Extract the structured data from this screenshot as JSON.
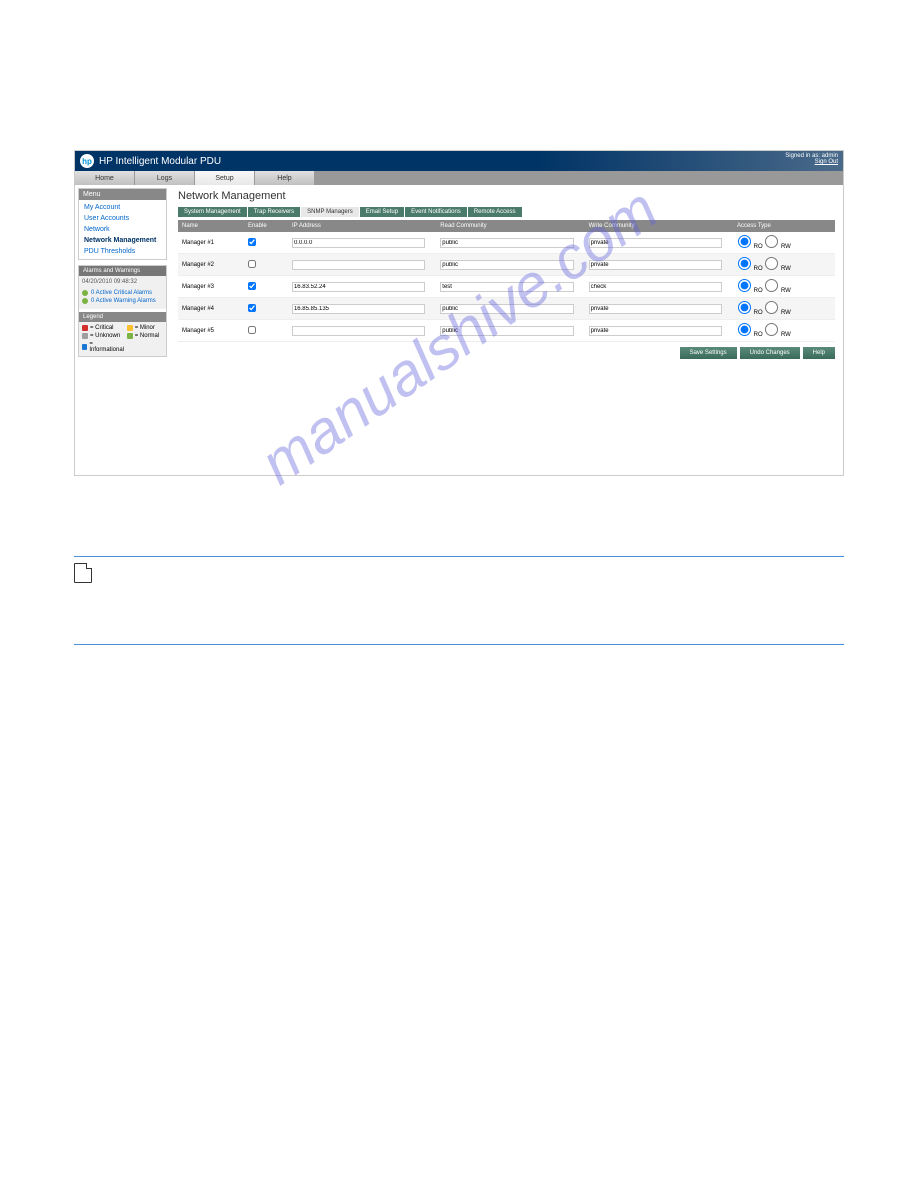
{
  "watermark": "manualshive.com",
  "header": {
    "logo_text": "hp",
    "title": "HP Intelligent Modular PDU",
    "signed_in": "Signed in as: admin",
    "sign_out": "Sign Out"
  },
  "tabs": {
    "items": [
      "Home",
      "Logs",
      "Setup",
      "Help"
    ],
    "active": 2
  },
  "menu": {
    "header": "Menu",
    "items": [
      "My Account",
      "User Accounts",
      "Network",
      "Network Management",
      "PDU Thresholds"
    ],
    "active": 3
  },
  "alarms": {
    "header": "Alarms and Warnings",
    "timestamp": "04/20/2010 09:48:32",
    "lines": [
      {
        "text": "0 Active Critical Alarms"
      },
      {
        "text": "0 Active Warning Alarms"
      }
    ]
  },
  "legend": {
    "header": "Legend",
    "items": [
      {
        "color": "red",
        "label": "= Critical"
      },
      {
        "color": "yellow",
        "label": "= Minor"
      },
      {
        "color": "grey",
        "label": "= Unknown"
      },
      {
        "color": "green",
        "label": "= Normal"
      },
      {
        "color": "blue",
        "label": "= Informational"
      }
    ]
  },
  "page": {
    "title": "Network Management",
    "sub_tabs": [
      "System Management",
      "Trap Receivers",
      "SNMP Managers",
      "Email Setup",
      "Event Notifications",
      "Remote Access"
    ],
    "sub_active": 2
  },
  "table": {
    "headers": [
      "Name",
      "Enable",
      "IP Address",
      "Read Community",
      "Write Community",
      "Access Type"
    ],
    "access_ro": "RO",
    "access_rw": "RW",
    "rows": [
      {
        "name": "Manager #1",
        "enabled": true,
        "ip": "0.0.0.0",
        "read": "public",
        "write": "private",
        "access": "ro"
      },
      {
        "name": "Manager #2",
        "enabled": false,
        "ip": "",
        "read": "public",
        "write": "private",
        "access": "ro"
      },
      {
        "name": "Manager #3",
        "enabled": true,
        "ip": "16.83.52.24",
        "read": "test",
        "write": "check",
        "access": "ro"
      },
      {
        "name": "Manager #4",
        "enabled": true,
        "ip": "16.85.85.135",
        "read": "public",
        "write": "private",
        "access": "ro"
      },
      {
        "name": "Manager #5",
        "enabled": false,
        "ip": "",
        "read": "public",
        "write": "private",
        "access": "ro"
      }
    ]
  },
  "buttons": {
    "save": "Save Settings",
    "undo": "Undo Changes",
    "help": "Help"
  }
}
